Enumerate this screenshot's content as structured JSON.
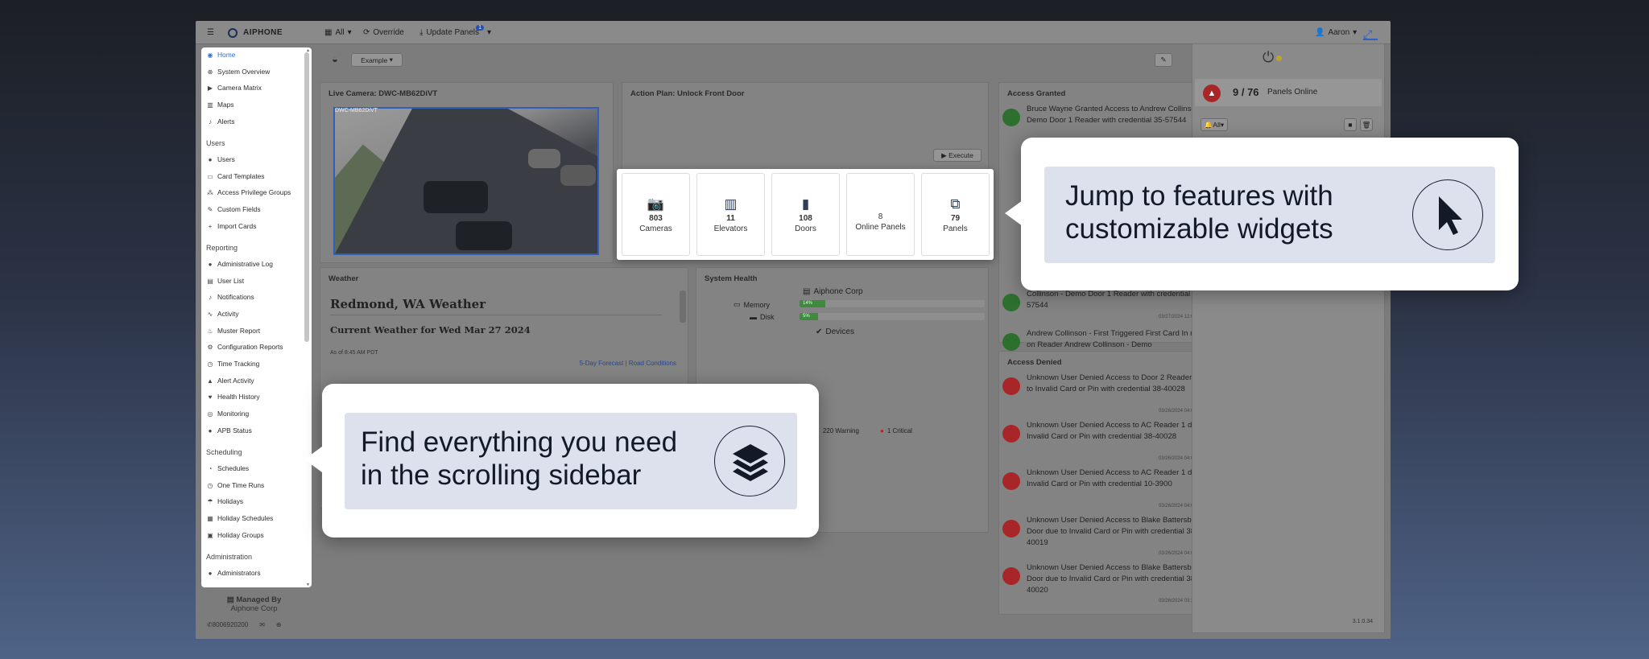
{
  "topbar": {
    "logo": "AIPHONE",
    "filter_label": "All",
    "override_label": "Override",
    "update_panels_label": "Update Panels",
    "update_badge": "1",
    "user_label": "Aaron"
  },
  "sidebar": {
    "items_main": [
      {
        "label": "Home",
        "icon": "home-icon"
      },
      {
        "label": "System Overview",
        "icon": "globe-icon"
      },
      {
        "label": "Camera Matrix",
        "icon": "video-icon"
      },
      {
        "label": "Maps",
        "icon": "map-icon"
      },
      {
        "label": "Alerts",
        "icon": "bell-icon"
      }
    ],
    "section_users": "Users",
    "items_users": [
      {
        "label": "Users"
      },
      {
        "label": "Card Templates"
      },
      {
        "label": "Access Privilege Groups"
      },
      {
        "label": "Custom Fields"
      },
      {
        "label": "Import Cards"
      }
    ],
    "section_reporting": "Reporting",
    "items_reporting": [
      {
        "label": "Administrative Log"
      },
      {
        "label": "User List"
      },
      {
        "label": "Notifications"
      },
      {
        "label": "Activity"
      },
      {
        "label": "Muster Report"
      },
      {
        "label": "Configuration Reports"
      },
      {
        "label": "Time Tracking"
      },
      {
        "label": "Alert Activity"
      },
      {
        "label": "Health History"
      },
      {
        "label": "Monitoring"
      },
      {
        "label": "APB Status"
      }
    ],
    "section_scheduling": "Scheduling",
    "items_scheduling": [
      {
        "label": "Schedules"
      },
      {
        "label": "One Time Runs"
      },
      {
        "label": "Holidays"
      },
      {
        "label": "Holiday Schedules"
      },
      {
        "label": "Holiday Groups"
      }
    ],
    "section_admin": "Administration",
    "items_admin": [
      {
        "label": "Administrators"
      }
    ],
    "footer": {
      "managed_by": "Managed By",
      "org": "Aiphone Corp",
      "phone": "8006920200"
    }
  },
  "dashboard": {
    "selector_label": "Example",
    "live_camera_title": "Live Camera: DWC-MB62DiVT",
    "camera_overlay": "DWC-MB62DiVT",
    "action_plan_title": "Action Plan: Unlock Front Door",
    "execute_label": "Execute",
    "weather_card_title": "Weather",
    "weather_heading": "Redmond, WA Weather",
    "weather_sub": "Current Weather for Wed Mar 27 2024",
    "weather_asof": "As of 8:45 AM PDT",
    "weather_link_forecast": "5-Day Forecast",
    "weather_link_sep": "|",
    "weather_link_road": "Road Conditions",
    "system_health_title": "System Health",
    "system_health_org": "Aiphone Corp",
    "memory_label": "Memory",
    "memory_pct": 14,
    "memory_text": "14%",
    "disk_label": "Disk",
    "disk_pct": 5,
    "disk_text": "5%",
    "devices_label": "Devices",
    "warning_text": "220 Warning",
    "critical_text": "1 Critical"
  },
  "widgets": [
    {
      "value": "803",
      "label": "Cameras",
      "icon": "camera-icon"
    },
    {
      "value": "11",
      "label": "Elevators",
      "icon": "building-icon"
    },
    {
      "value": "108",
      "label": "Doors",
      "icon": "door-icon"
    },
    {
      "value": "8",
      "label": "Online Panels",
      "icon": ""
    },
    {
      "value": "79",
      "label": "Panels",
      "icon": "network-icon"
    }
  ],
  "access_granted": {
    "title": "Access Granted",
    "items": [
      {
        "text": "Bruce Wayne Granted Access to Andrew Collinson - Demo Door 1 Reader with credential 35-57544"
      },
      {
        "text": "Collinson - Demo Door 1 Reader with credential 35-57544",
        "time": "03/27/2024 12:00:36 am"
      },
      {
        "text": "Andrew Collinson - First Triggered First Card In mode on Reader Andrew Collinson - Demo"
      }
    ]
  },
  "access_denied": {
    "title": "Access Denied",
    "items": [
      {
        "text": "Unknown User Denied Access to Door 2 Reader due to Invalid Card or Pin with credential 38-40028",
        "time": "03/26/2024 04:04:09 am"
      },
      {
        "text": "Unknown User Denied Access to AC Reader 1 due to Invalid Card or Pin with credential 38-40028",
        "time": "03/26/2024 04:01:03 am"
      },
      {
        "text": "Unknown User Denied Access to AC Reader 1 due to Invalid Card or Pin with credential 10-3900",
        "time": "03/26/2024 04:00:50 am"
      },
      {
        "text": "Unknown User Denied Access to Blake Battersby Door due to Invalid Card or Pin with credential 38-40019",
        "time": "03/26/2024 04:01:02 am"
      },
      {
        "text": "Unknown User Denied Access to Blake Battersby Door due to Invalid Card or Pin with credential 38-40020",
        "time": "03/26/2024 03:20:41 am"
      }
    ]
  },
  "right_panel": {
    "panels_count": "9 / 76",
    "panels_label": "Panels Online",
    "filter_label": "All",
    "version": "3.1.0.34"
  },
  "callouts": {
    "widgets_line1": "Jump to features with",
    "widgets_line2": "customizable widgets",
    "sidebar_line1": "Find everything you need",
    "sidebar_line2": "in the scrolling sidebar"
  }
}
